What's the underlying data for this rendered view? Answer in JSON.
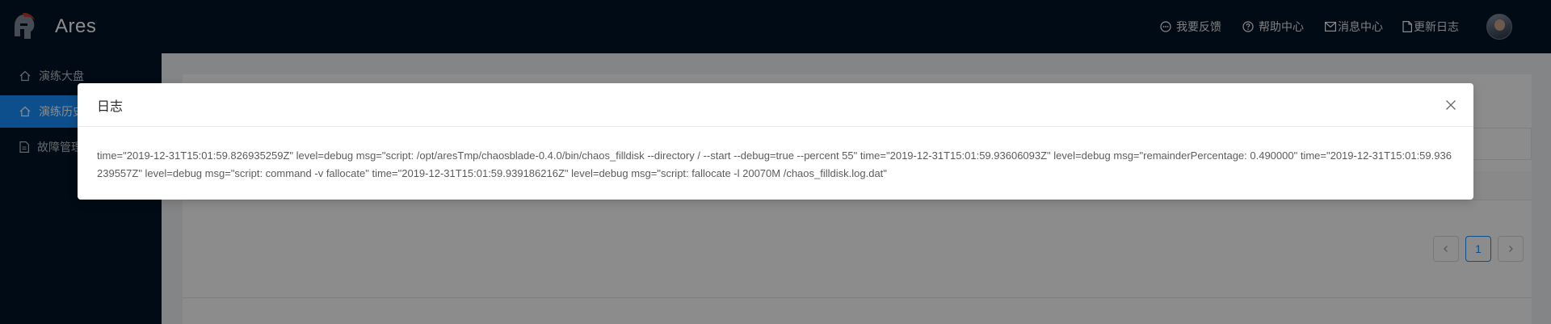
{
  "header": {
    "app_title": "Ares",
    "nav": [
      {
        "label": "我要反馈",
        "icon": "message-icon"
      },
      {
        "label": "帮助中心",
        "icon": "question-circle-icon"
      },
      {
        "label": "消息中心",
        "icon": "mail-icon"
      },
      {
        "label": "更新日志",
        "icon": "file-icon"
      }
    ]
  },
  "sidebar": {
    "items": [
      {
        "label": "演练大盘",
        "icon": "home-icon"
      },
      {
        "label": "演练历史",
        "icon": "home-icon",
        "active": true
      },
      {
        "label": "故障管理",
        "icon": "file-text-icon"
      }
    ]
  },
  "pagination": {
    "current": "1",
    "prev_icon": "chevron-left-icon",
    "next_icon": "chevron-right-icon"
  },
  "modal": {
    "title": "日志",
    "close_icon": "close-icon",
    "log_text": "time=\"2019-12-31T15:01:59.826935259Z\" level=debug msg=\"script: /opt/aresTmp/chaosblade-0.4.0/bin/chaos_filldisk --directory / --start --debug=true --percent 55\" time=\"2019-12-31T15:01:59.93606093Z\" level=debug msg=\"remainderPercentage: 0.490000\" time=\"2019-12-31T15:01:59.936239557Z\" level=debug msg=\"script: command -v fallocate\" time=\"2019-12-31T15:01:59.939186216Z\" level=debug msg=\"script: fallocate -l 20070M /chaos_filldisk.log.dat\""
  },
  "colors": {
    "header_bg": "#001529",
    "sidebar_bg": "#001529",
    "accent": "#1890ff",
    "mask": "rgba(0,0,0,0.45)"
  }
}
